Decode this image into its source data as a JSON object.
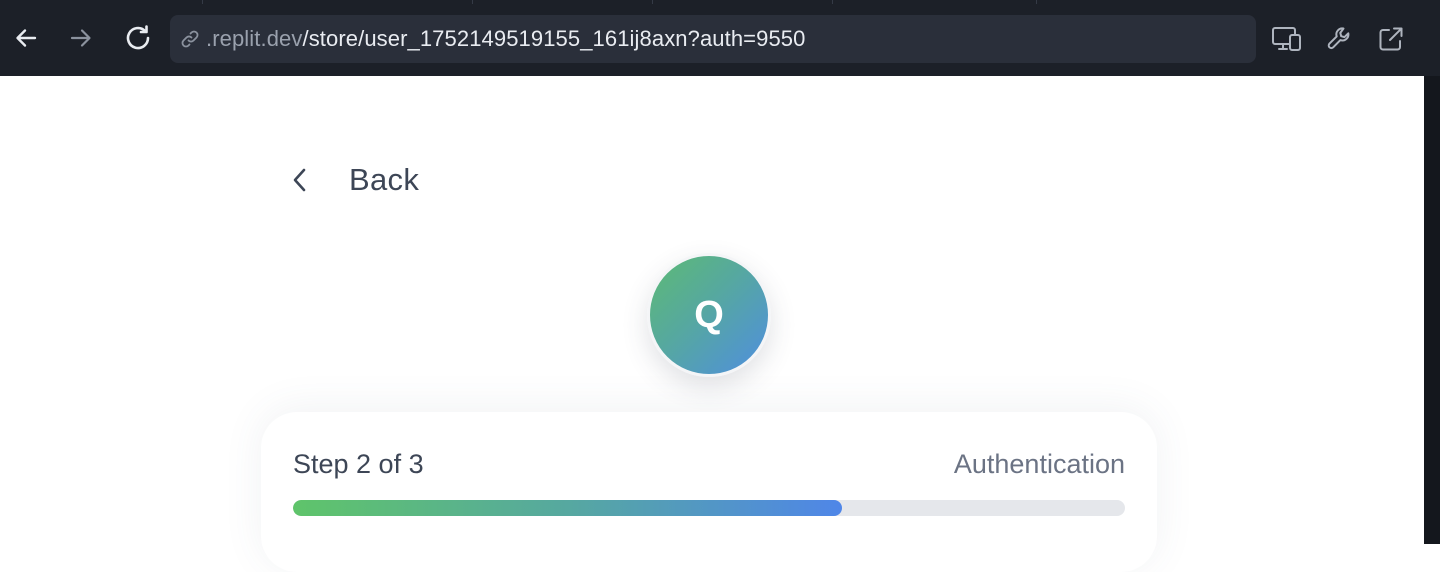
{
  "browser": {
    "url_domain": ".replit.dev",
    "url_path": "/store/user_1752149519155_161ij8axn?auth=9550",
    "icons": {
      "back": "arrow-left-icon",
      "forward": "arrow-right-icon",
      "reload": "reload-icon",
      "link": "link-icon",
      "devices": "devices-icon",
      "tools": "wrench-icon",
      "open_external": "external-link-icon"
    }
  },
  "page": {
    "back_label": "Back",
    "avatar_initial": "Q",
    "progress": {
      "step_label": "Step 2 of 3",
      "stage_label": "Authentication",
      "fraction": 0.66
    },
    "colors": {
      "gradient_start": "#5fc46a",
      "gradient_end": "#4f86e8",
      "text_primary": "#3d4656",
      "text_secondary": "#6b7384"
    }
  }
}
